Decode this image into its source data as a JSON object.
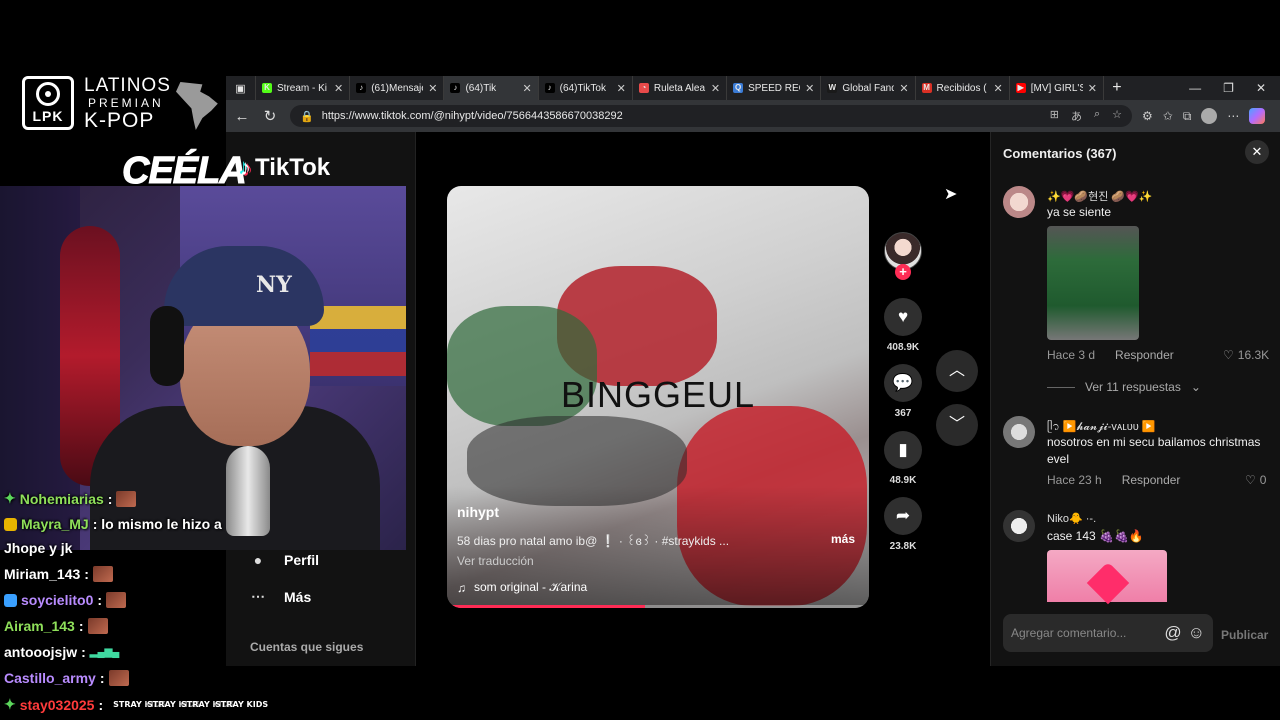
{
  "overlay": {
    "logo_badge": "LPK",
    "logo_line1": "LATINOS",
    "logo_line2": "PREMIAN",
    "logo_line3": "K-POP",
    "cee_text": "CEÉLA",
    "tiktok_brand": "TikTok"
  },
  "browser": {
    "tabs": [
      {
        "label": "Stream - Ki",
        "favicon": "K",
        "color": "#53fc18"
      },
      {
        "label": "(61)Mensaje",
        "favicon": "♪",
        "color": "#000000"
      },
      {
        "label": "(64)Tik",
        "favicon": "♪",
        "color": "#000000"
      },
      {
        "label": "(64)TikTok",
        "favicon": "♪",
        "color": "#000000"
      },
      {
        "label": "Ruleta Alea",
        "favicon": "◔",
        "color": "#e84a4a"
      },
      {
        "label": "SPEED REC",
        "favicon": "Q",
        "color": "#3a7bd5"
      },
      {
        "label": "Global Fand",
        "favicon": "W",
        "color": "#1a1a1a"
      },
      {
        "label": "Recibidos (",
        "favicon": "M",
        "color": "#d93025"
      },
      {
        "label": "[MV] GIRL'S",
        "favicon": "▶",
        "color": "#ff0000"
      }
    ],
    "url": "https://www.tiktok.com/@nihypt/video/7566443586670038292"
  },
  "sidebar": {
    "items": [
      {
        "label": "Perfil",
        "icon": "user-icon"
      },
      {
        "label": "Más",
        "icon": "more-icon"
      }
    ],
    "following_label": "Cuentas que sigues"
  },
  "video": {
    "overlay_text": "BINGGEUL",
    "author": "nihypt",
    "description": "58 dias pro natal amo ib@ ❕ · ꒰ɞ꒱ · #straykids ...",
    "more_label": "más",
    "translate_label": "Ver traducción",
    "sound": "som original - 𝒦arina",
    "progress_percent": 47
  },
  "actions": {
    "likes": "408.9K",
    "comments": "367",
    "saves": "48.9K",
    "shares": "23.8K"
  },
  "comments_panel": {
    "title": "Comentarios (367)",
    "comments": [
      {
        "name": "✨💗🥔현진 🥔💗✨",
        "text": "ya se siente",
        "time": "Hace 3 d",
        "reply": "Responder",
        "likes": "16.3K"
      },
      {
        "name": "ᥫ᭡ ▶️𝓱𝓪𝓷𝓳𝓲-ᴠᴀʟᴜᴜ ▶️",
        "text": "nosotros en mi secu bailamos christmas evel",
        "time": "Hace 23 h",
        "reply": "Responder",
        "likes": "0"
      },
      {
        "name": "Niko🐥 ·-.",
        "text": "case 143 🍇🍇🔥"
      }
    ],
    "replies_label": "Ver 11 respuestas",
    "input_placeholder": "Agregar comentario...",
    "post_label": "Publicar"
  },
  "chat": [
    {
      "user": "Nohemiarias",
      "color": "#8fe05a",
      "msg": ":"
    },
    {
      "user": "Mayra_MJ",
      "color": "#8fe05a",
      "msg": ": lo mismo le hizo a"
    },
    {
      "user": "",
      "color": "#ffffff",
      "msg": "Jhope y jk"
    },
    {
      "user": "Miriam_143",
      "color": "#ffffff",
      "msg": ":"
    },
    {
      "user": "soycielito0",
      "color": "#b98cff",
      "msg": ":"
    },
    {
      "user": "Airam_143",
      "color": "#8fe05a",
      "msg": ":"
    },
    {
      "user": "antooojsjw",
      "color": "#ffffff",
      "msg": ":"
    },
    {
      "user": "Castillo_army",
      "color": "#b98cff",
      "msg": ":"
    },
    {
      "user": "stay032025",
      "color": "#ff3b3b",
      "msg": ":"
    }
  ],
  "stray_kids_badge": "STRAY KIDS"
}
